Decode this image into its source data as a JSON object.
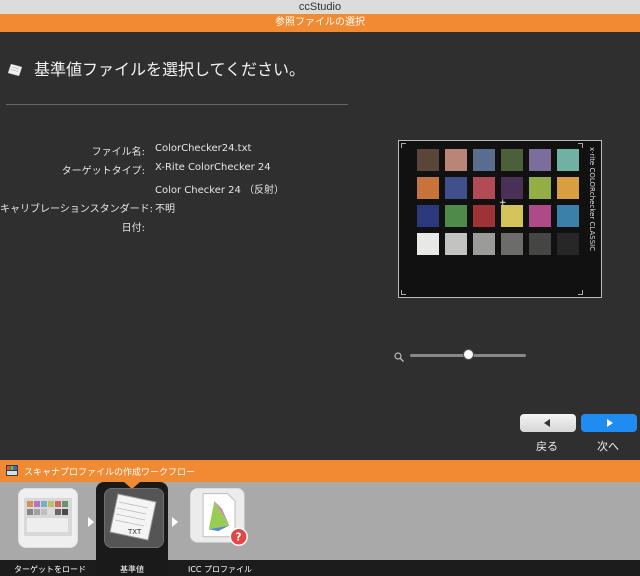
{
  "app": {
    "title": "ccStudio",
    "subtitle": "参照ファイルの選択"
  },
  "main": {
    "heading": "基準値ファイルを選択してください。",
    "fields": [
      {
        "label": "ファイル名:",
        "value": "ColorChecker24.txt"
      },
      {
        "label": "ターゲットタイプ:",
        "value": "X-Rite ColorChecker 24"
      },
      {
        "label": "",
        "value": "Color Checker 24 （反射）"
      },
      {
        "label": "キャリブレーションスタンダード:",
        "value": "不明"
      },
      {
        "label": "日付:",
        "value": ""
      }
    ]
  },
  "preview": {
    "brand_text": "x·rite  COLORchecker CLASSIC",
    "patches": [
      "#5a4638",
      "#b98576",
      "#5b6d8f",
      "#4d5e3a",
      "#7d6d9a",
      "#6fb1a2",
      "#c8733a",
      "#41508a",
      "#b24b56",
      "#4a2f57",
      "#93ae45",
      "#d79f40",
      "#2c3a7d",
      "#4f8a4b",
      "#9d3335",
      "#d5c45a",
      "#ad4a87",
      "#3b80a8",
      "#e8e8e6",
      "#c3c3c1",
      "#9b9b99",
      "#6c6c6b",
      "#454544",
      "#272727"
    ],
    "zoom_level": 0.5
  },
  "nav": {
    "back_label": "戻る",
    "next_label": "次へ"
  },
  "workflow": {
    "title": "スキャナプロファイルの作成ワークフロー",
    "steps": [
      {
        "label": "ターゲットをロード"
      },
      {
        "label": "基準値"
      },
      {
        "label": "ICC プロファイル"
      }
    ],
    "active_step": 1,
    "colors": {
      "accent": "#f08a33",
      "next_button": "#1e8cf0",
      "warning_badge": "#e04848"
    }
  }
}
